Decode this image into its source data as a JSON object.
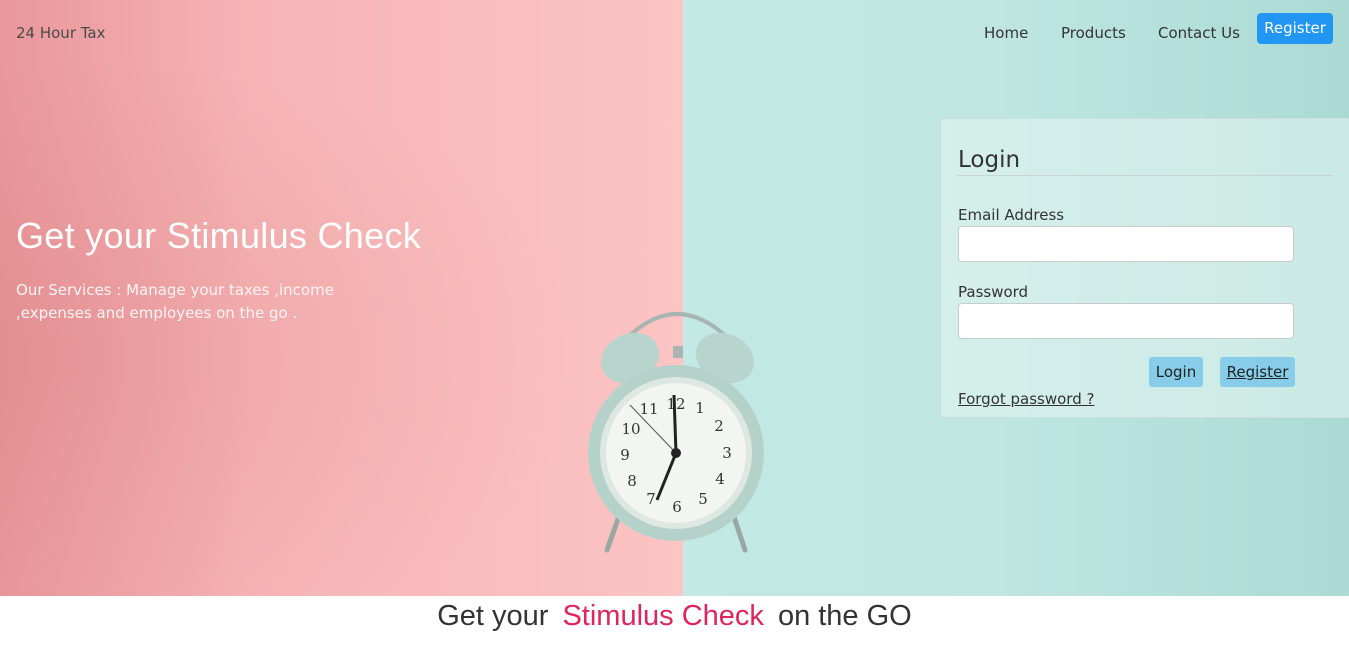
{
  "brand": "24 Hour Tax",
  "nav": {
    "home": "Home",
    "products": "Products",
    "contact": "Contact Us",
    "register": "Register"
  },
  "hero": {
    "title": "Get your Stimulus Check",
    "text": "Our Services : Manage your taxes ,income ,expenses and employees on the go ."
  },
  "login": {
    "title": "Login",
    "email_label": "Email Address",
    "email_value": "",
    "password_label": "Password",
    "password_value": "",
    "login_button": "Login",
    "register_button": "Register",
    "forgot": "Forgot password ?"
  },
  "tagline": {
    "before": "Get your",
    "highlight": "Stimulus Check",
    "after": "on the GO"
  },
  "colors": {
    "accent_blue": "#2196f3",
    "button_light_blue": "#87cdea",
    "highlight_pink": "#e0245e",
    "pink_bg": "#fcc4c3",
    "mint_bg": "#bfe6e1"
  }
}
